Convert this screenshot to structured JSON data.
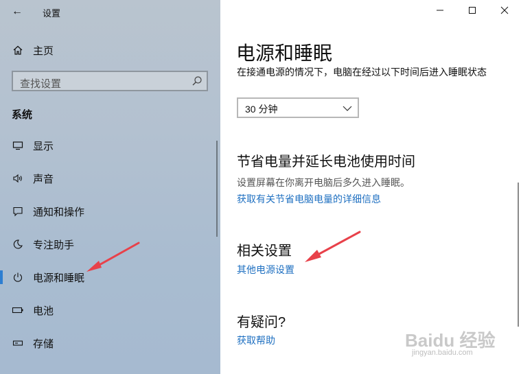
{
  "window": {
    "title": "设置"
  },
  "sidebar": {
    "home_label": "主页",
    "search_placeholder": "查找设置",
    "section_label": "系统",
    "items": [
      {
        "label": "显示",
        "icon": "display-icon"
      },
      {
        "label": "声音",
        "icon": "sound-icon"
      },
      {
        "label": "通知和操作",
        "icon": "notification-icon"
      },
      {
        "label": "专注助手",
        "icon": "moon-icon"
      },
      {
        "label": "电源和睡眠",
        "icon": "power-icon",
        "active": true
      },
      {
        "label": "电池",
        "icon": "battery-icon"
      },
      {
        "label": "存储",
        "icon": "storage-icon"
      }
    ]
  },
  "main": {
    "title": "电源和睡眠",
    "sleep_desc": "在接通电源的情况下，电脑在经过以下时间后进入睡眠状态",
    "sleep_value": "30 分钟",
    "save_heading": "节省电量并延长电池使用时间",
    "save_desc": "设置屏幕在你离开电脑后多久进入睡眠。",
    "save_link": "获取有关节省电脑电量的详细信息",
    "related_heading": "相关设置",
    "related_link": "其他电源设置",
    "question_heading": "有疑问?",
    "help_link": "获取帮助"
  },
  "watermark": {
    "brand": "Baidu 经验",
    "url": "jingyan.baidu.com"
  },
  "colors": {
    "accent": "#2d7ed1",
    "link": "#1f70c1",
    "annotation_arrow": "#e8414a"
  }
}
